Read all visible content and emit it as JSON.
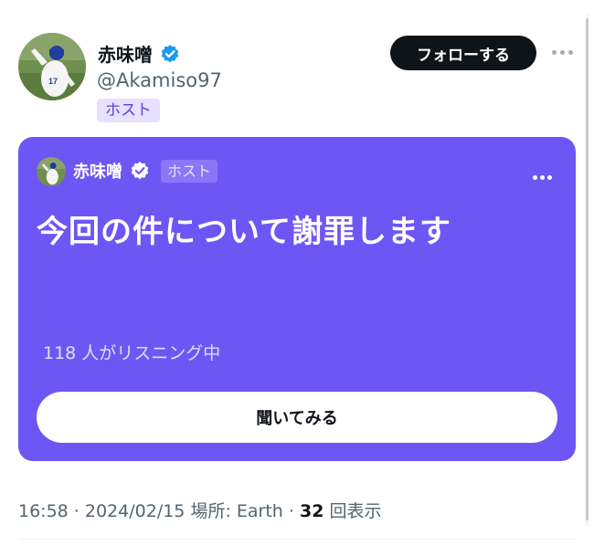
{
  "author": {
    "name": "赤味噌",
    "handle": "@Akamiso97",
    "role_badge": "ホスト",
    "verified_icon": "verified-badge-icon",
    "verified_color": "#1d9bf0"
  },
  "header": {
    "follow_label": "フォローする",
    "more_icon": "more-horizontal-icon"
  },
  "space_card": {
    "background_color": "#6e56f5",
    "host_name": "赤味噌",
    "host_badge": "ホスト",
    "title": "今回の件について謝罪します",
    "listeners": "118 人がリスニング中",
    "listen_button_label": "聞いてみる",
    "more_icon": "more-horizontal-icon"
  },
  "meta": {
    "time": "16:58",
    "sep1": " · ",
    "date": "2024/02/15",
    "location": " 場所: Earth",
    "sep2": " · ",
    "view_count": "32",
    "view_label": " 回表示"
  }
}
